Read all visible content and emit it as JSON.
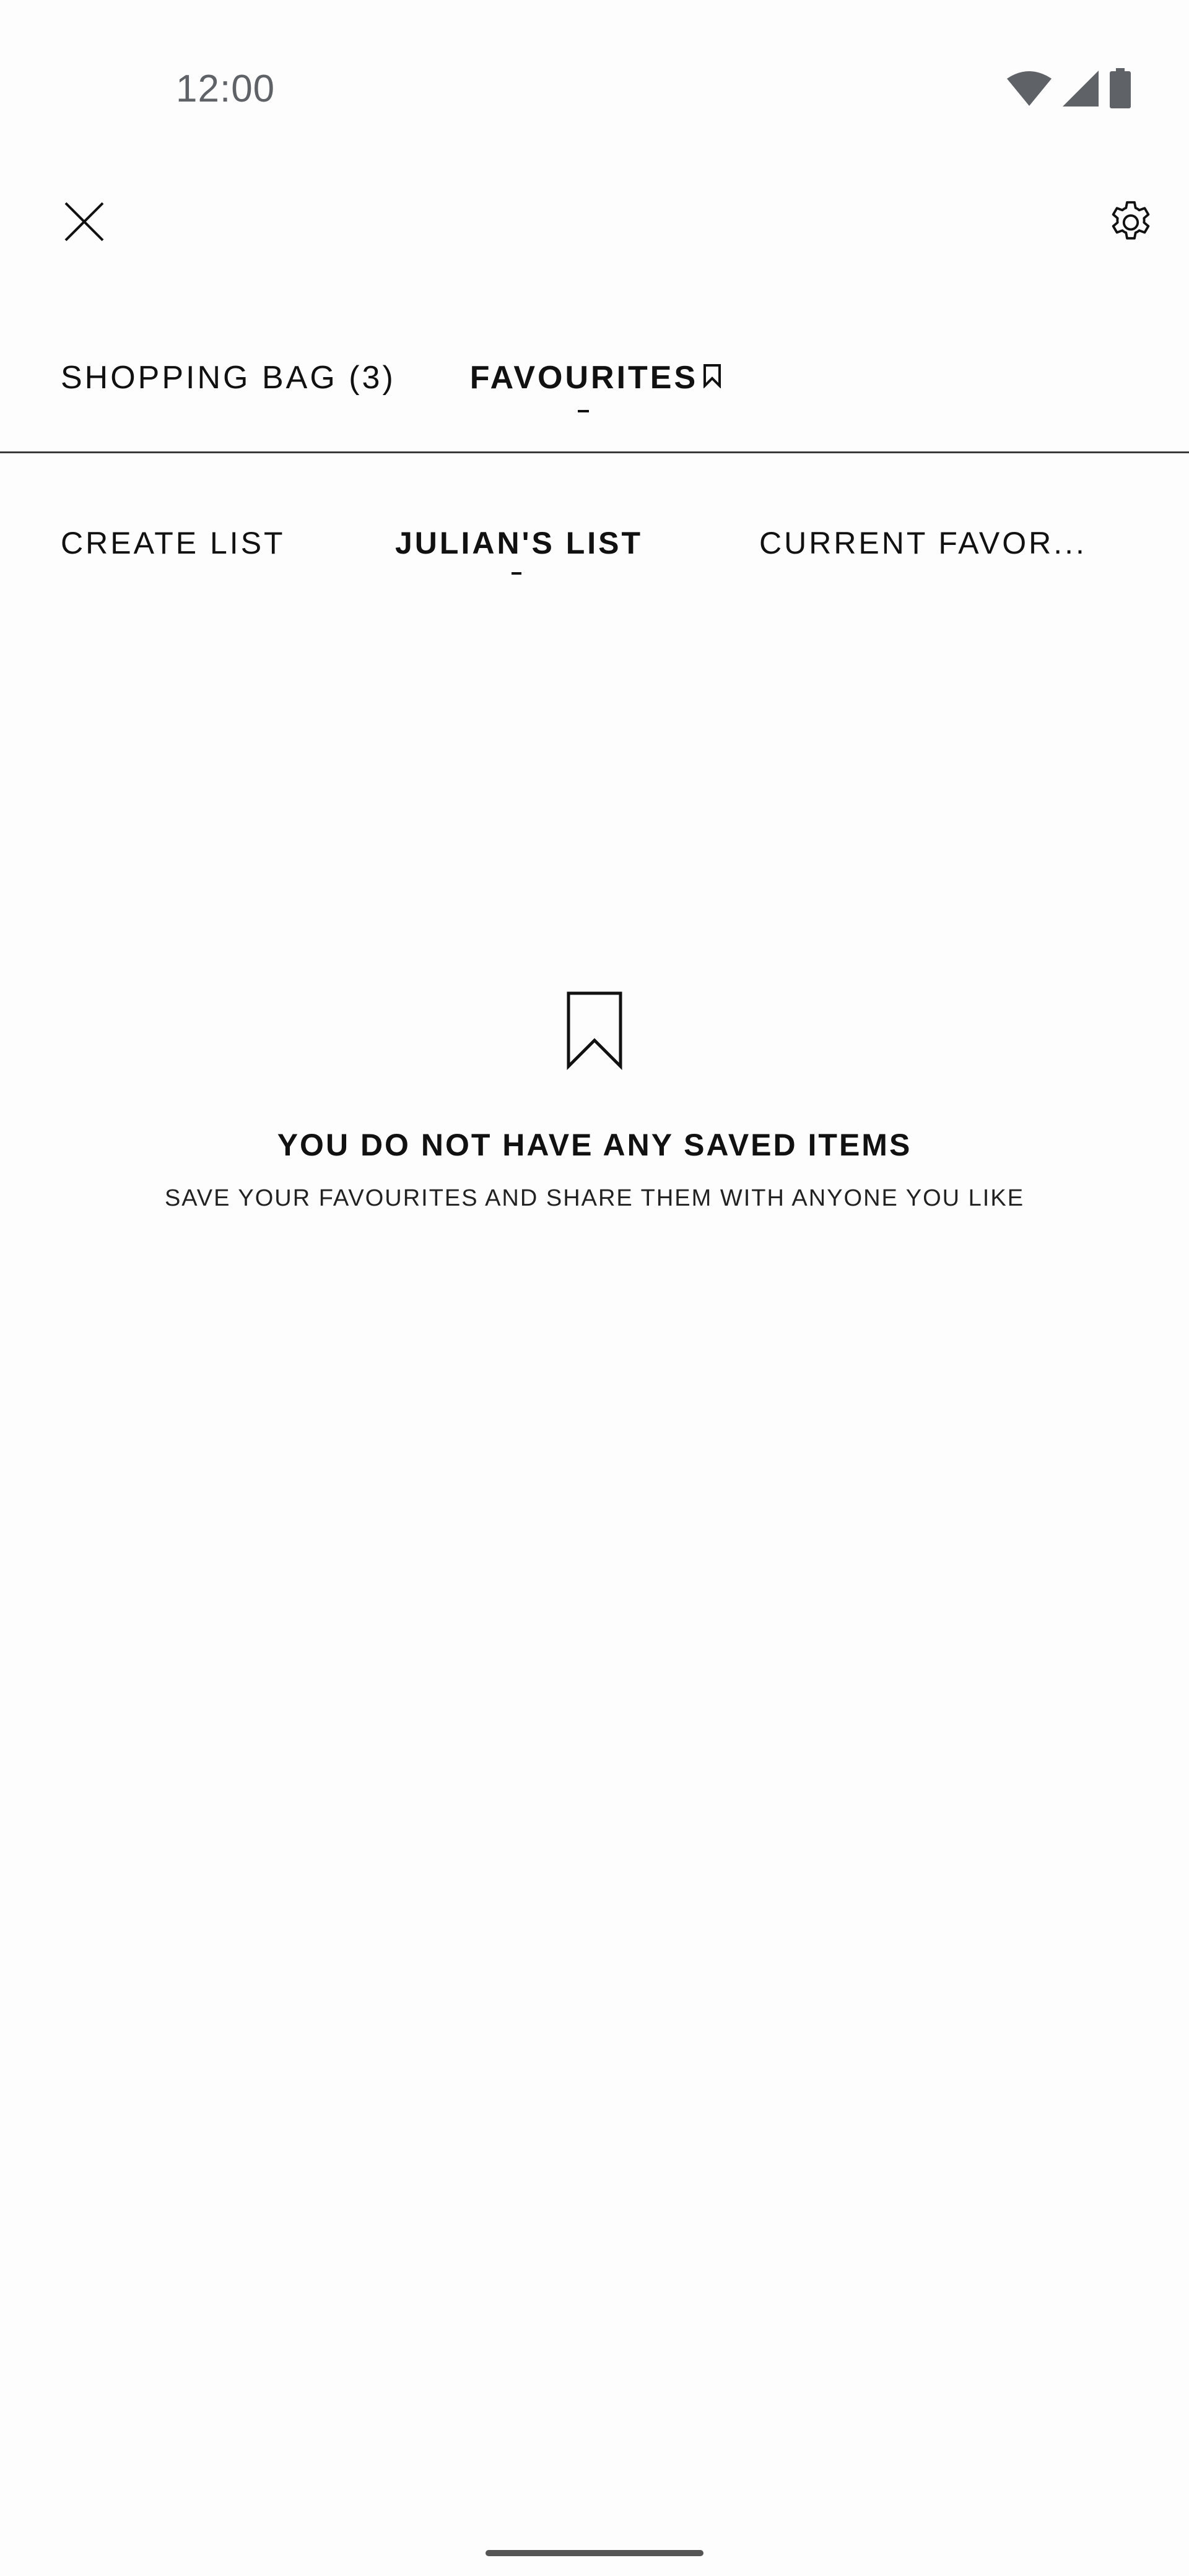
{
  "status_bar": {
    "time": "12:00",
    "icons": [
      "wifi-icon",
      "signal-icon",
      "battery-icon"
    ]
  },
  "toolbar": {
    "close_icon": "close-icon",
    "settings_icon": "gear-icon"
  },
  "main_tabs": [
    {
      "label": "SHOPPING BAG (3)",
      "active": false
    },
    {
      "label": "FAVOURITES",
      "active": true,
      "icon": "bookmark-icon"
    }
  ],
  "sub_tabs": [
    {
      "label": "CREATE LIST",
      "active": false
    },
    {
      "label": "JULIAN'S LIST",
      "active": true
    },
    {
      "label": "CURRENT FAVOR...",
      "active": false
    }
  ],
  "empty_state": {
    "icon": "bookmark-icon",
    "title": "YOU DO NOT HAVE ANY SAVED ITEMS",
    "subtitle": "SAVE YOUR FAVOURITES AND SHARE THEM WITH ANYONE YOU LIKE"
  },
  "colors": {
    "text": "#111111",
    "status_gray": "#5f6368",
    "background": "#fdfdfd"
  }
}
